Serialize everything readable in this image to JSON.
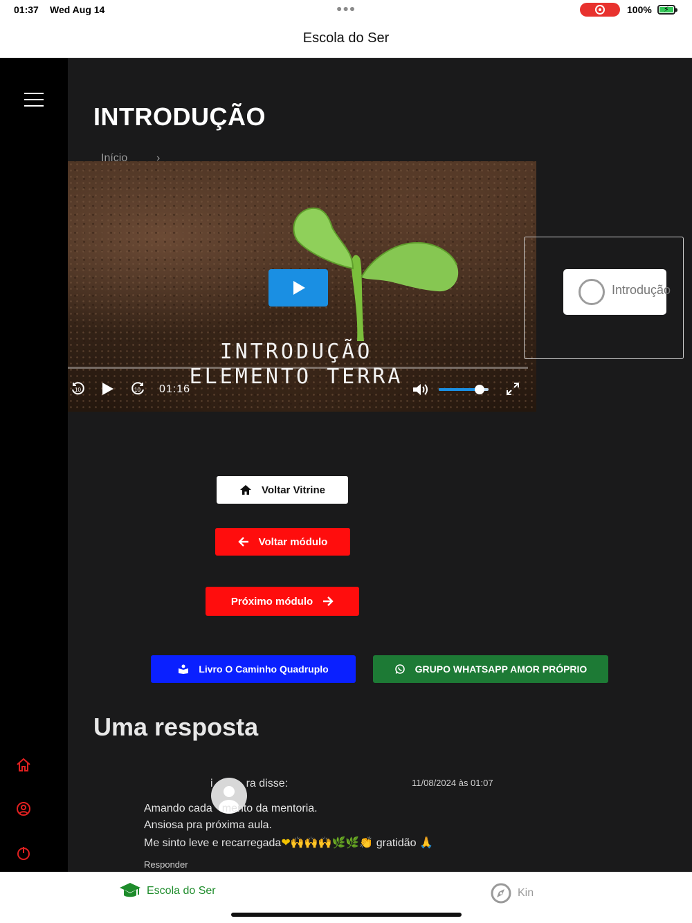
{
  "status_bar": {
    "time": "01:37",
    "date": "Wed Aug 14",
    "battery_percent": "100%",
    "battery_level": 1.0,
    "recording_color": "#e8322e"
  },
  "header": {
    "title": "Escola do Ser"
  },
  "sidebar": {
    "menu_icon": "hamburger-menu-icon",
    "icons": [
      "home-icon",
      "user-circle-icon",
      "power-icon"
    ],
    "icon_color": "#e02020"
  },
  "page": {
    "title": "INTRODUÇÃO",
    "breadcrumb": "Início"
  },
  "video": {
    "caption_line1": "INTRODUÇÃO",
    "caption_line2": "ELEMENTO TERRA",
    "time": "01:16",
    "volume": 0.9,
    "accent": "#1a8fe3"
  },
  "lessons": [
    {
      "label": "Introdução",
      "complete": false
    }
  ],
  "buttons": {
    "back_showcase": "Voltar Vitrine",
    "back_module": "Voltar módulo",
    "next_module": "Próximo módulo",
    "book": "Livro O Caminho Quadruplo",
    "whatsapp": "GRUPO WHATSAPP AMOR PRÓPRIO"
  },
  "colors": {
    "red": "#ff0d0d",
    "blue": "#0a20ff",
    "green": "#1d7a35",
    "tab_active": "#1e8c2b"
  },
  "comments": {
    "heading": "Uma resposta",
    "items": [
      {
        "author_suffix": "ra disse:",
        "author_prefix": "i",
        "date": "11/08/2024 às 01:07",
        "line1_start": "Amando cada",
        "line1_end": "mento da mentoria.",
        "line2": "Ansiosa pra próxima aula.",
        "line3_start": "Me sinto leve e recarregada",
        "line3_emojis": "❤🙌🙌🙌🌿🌿👏",
        "line3_end": " gratidão 🙏",
        "reply": "Responder"
      }
    ]
  },
  "tabbar": {
    "tabs": [
      {
        "label": "Escola do Ser",
        "icon": "graduation-cap-icon",
        "active": true
      },
      {
        "label": "Kin",
        "icon": "compass-icon",
        "active": false
      }
    ]
  }
}
